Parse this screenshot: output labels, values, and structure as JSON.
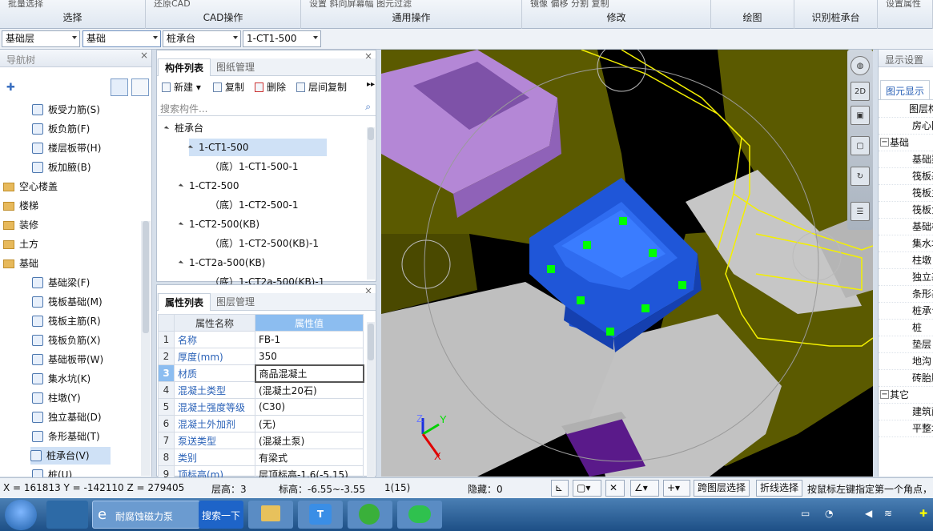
{
  "ribbon": {
    "groups": [
      {
        "cut": "批量选择",
        "label": "选择"
      },
      {
        "cut": "还原CAD",
        "label": "CAD操作"
      },
      {
        "cut": "设置   斜向屏幕幅   图元过滤",
        "label": "通用操作"
      },
      {
        "cut": "镜像   偏移   分割   复制",
        "label": "修改"
      },
      {
        "cut": "",
        "label": "绘图"
      },
      {
        "cut": "",
        "label": "识别桩承台"
      },
      {
        "cut": "设置属性",
        "label": ""
      }
    ]
  },
  "selectors": [
    "基础层",
    "基础",
    "桩承台",
    "1-CT1-500"
  ],
  "nav": {
    "title": "导航树",
    "items": [
      {
        "label": "板受力筋(S)",
        "kind": "item"
      },
      {
        "label": "板负筋(F)",
        "kind": "item"
      },
      {
        "label": "楼层板带(H)",
        "kind": "item"
      },
      {
        "label": "板加腋(B)",
        "kind": "item"
      },
      {
        "label": "空心楼盖",
        "kind": "folder"
      },
      {
        "label": "楼梯",
        "kind": "folder"
      },
      {
        "label": "装修",
        "kind": "folder"
      },
      {
        "label": "土方",
        "kind": "folder"
      },
      {
        "label": "基础",
        "kind": "folder-open"
      },
      {
        "label": "基础梁(F)",
        "kind": "item"
      },
      {
        "label": "筏板基础(M)",
        "kind": "item"
      },
      {
        "label": "筏板主筋(R)",
        "kind": "item"
      },
      {
        "label": "筏板负筋(X)",
        "kind": "item"
      },
      {
        "label": "基础板带(W)",
        "kind": "item"
      },
      {
        "label": "集水坑(K)",
        "kind": "item"
      },
      {
        "label": "柱墩(Y)",
        "kind": "item"
      },
      {
        "label": "独立基础(D)",
        "kind": "item"
      },
      {
        "label": "条形基础(T)",
        "kind": "item"
      },
      {
        "label": "桩承台(V)",
        "kind": "item-selected"
      },
      {
        "label": "桩(U)",
        "kind": "item"
      }
    ]
  },
  "comp": {
    "tabs": [
      "构件列表",
      "图纸管理"
    ],
    "toolbar": [
      "新建",
      "复制",
      "删除",
      "层间复制"
    ],
    "search_placeholder": "搜索构件...",
    "tree": [
      {
        "label": "桩承台",
        "level": 0,
        "arrow": true
      },
      {
        "label": "1-CT1-500",
        "level": 1,
        "arrow": true,
        "hl": true
      },
      {
        "label": "（底）1-CT1-500-1",
        "level": 2
      },
      {
        "label": "1-CT2-500",
        "level": 1,
        "arrow": true
      },
      {
        "label": "（底）1-CT2-500-1",
        "level": 2
      },
      {
        "label": "1-CT2-500(KB)",
        "level": 1,
        "arrow": true
      },
      {
        "label": "（底）1-CT2-500(KB)-1",
        "level": 2
      },
      {
        "label": "1-CT2a-500(KB)",
        "level": 1,
        "arrow": true
      },
      {
        "label": "（底）1-CT2a-500(KB)-1",
        "level": 2
      }
    ]
  },
  "props": {
    "tabs": [
      "属性列表",
      "图层管理"
    ],
    "headers": [
      "属性名称",
      "属性值"
    ],
    "rows": [
      {
        "n": "1",
        "name": "名称",
        "val": "FB-1"
      },
      {
        "n": "2",
        "name": "厚度(mm)",
        "val": "350"
      },
      {
        "n": "3",
        "name": "材质",
        "val": "商品混凝土"
      },
      {
        "n": "4",
        "name": "混凝土类型",
        "val": "(混凝土20石)"
      },
      {
        "n": "5",
        "name": "混凝土强度等级",
        "val": "(C30)"
      },
      {
        "n": "6",
        "name": "混凝土外加剂",
        "val": "(无)"
      },
      {
        "n": "7",
        "name": "泵送类型",
        "val": "(混凝土泵)"
      },
      {
        "n": "8",
        "name": "类别",
        "val": "有梁式"
      },
      {
        "n": "9",
        "name": "顶标高(m)",
        "val": "层顶标高-1.6(-5.15)"
      }
    ]
  },
  "view": {
    "colors": {
      "olive": "#5b5a00",
      "gray": "#c0c0c0",
      "purple": "#b487d6",
      "blue": "#1f56d8",
      "yellow": "#f4f000",
      "green": "#00ff00"
    },
    "axis": {
      "x": "X",
      "y": "Y",
      "z": "Z"
    },
    "tools": [
      "globe-icon",
      "2D",
      "cube-front-icon",
      "cube-icon",
      "rotate-icon",
      "layers-icon"
    ]
  },
  "rpanel": {
    "title": "显示设置",
    "tab": "图元显示",
    "rows": [
      {
        "label": "图层构",
        "indent": 1
      },
      {
        "label": "房心回",
        "indent": 2
      },
      {
        "label": "基础",
        "indent": 0,
        "group": true
      },
      {
        "label": "基础梁",
        "indent": 2
      },
      {
        "label": "筏板基",
        "indent": 2
      },
      {
        "label": "筏板主",
        "indent": 2
      },
      {
        "label": "筏板负",
        "indent": 2
      },
      {
        "label": "基础板",
        "indent": 2
      },
      {
        "label": "集水坑",
        "indent": 2
      },
      {
        "label": "柱墩",
        "indent": 2
      },
      {
        "label": "独立基",
        "indent": 2
      },
      {
        "label": "条形基",
        "indent": 2
      },
      {
        "label": "桩承台",
        "indent": 2
      },
      {
        "label": "桩",
        "indent": 2
      },
      {
        "label": "垫层",
        "indent": 2
      },
      {
        "label": "地沟",
        "indent": 2
      },
      {
        "label": "砖胎膜",
        "indent": 2
      },
      {
        "label": "其它",
        "indent": 0,
        "group": true
      },
      {
        "label": "建筑面",
        "indent": 2
      },
      {
        "label": "平整场",
        "indent": 2
      }
    ]
  },
  "status": {
    "coords": "X = 161813 Y = -142110 Z = 279405",
    "floor_height": "层高：3",
    "elevation": "标高：-6.55~-3.55",
    "count": "1(15)",
    "hidden": "隐藏：0",
    "btn_cross_layer": "跨图层选择",
    "btn_polyline": "折线选择",
    "hint": "按鼠标左键指定第一个角点，"
  },
  "taskbar": {
    "ie_label": "耐腐蚀磁力泵",
    "search_label": "搜索一下"
  }
}
